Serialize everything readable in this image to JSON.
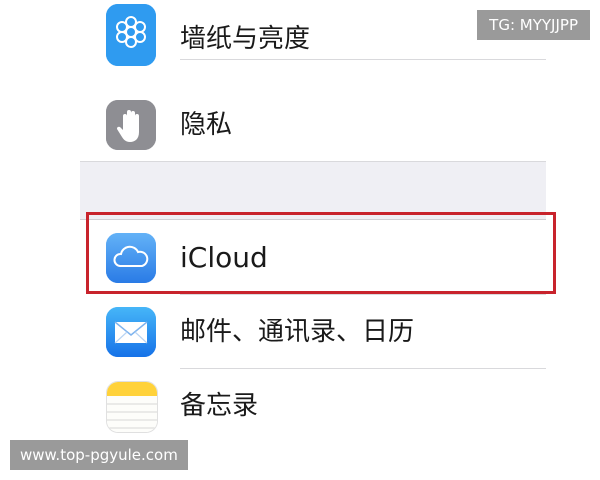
{
  "watermarks": {
    "top_right": "TG: MYYJJPP",
    "bottom_left": "www.top-pgyule.com"
  },
  "settings": {
    "rows": [
      {
        "label": "墙纸与亮度",
        "icon": "wallpaper-flower-icon"
      },
      {
        "label": "隐私",
        "icon": "privacy-hand-icon"
      },
      {
        "label": "iCloud",
        "icon": "icloud-icon"
      },
      {
        "label": "邮件、通讯录、日历",
        "icon": "mail-envelope-icon"
      },
      {
        "label": "备忘录",
        "icon": "notes-icon"
      }
    ]
  },
  "highlight": {
    "color": "#c8232c",
    "target": "iCloud"
  }
}
